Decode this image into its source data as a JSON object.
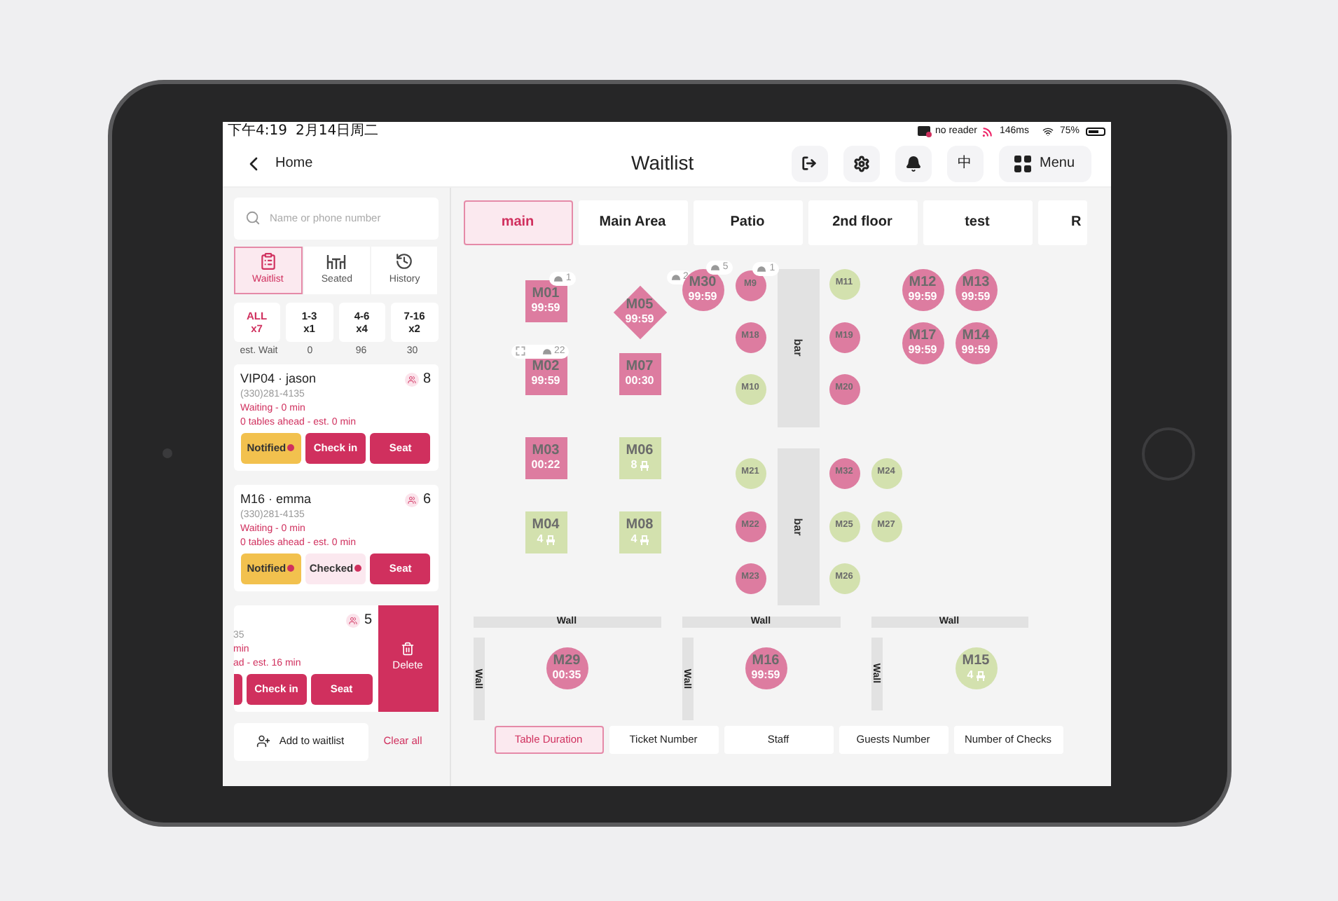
{
  "status_bar": {
    "time": "下午4:19",
    "date": "2月14日周二",
    "reader": "no reader",
    "latency": "146ms",
    "battery": "75%"
  },
  "header": {
    "back": "Home",
    "title": "Waitlist",
    "language": "中",
    "menu": "Menu"
  },
  "search": {
    "placeholder": "Name or phone number"
  },
  "views": [
    {
      "label": "Waitlist",
      "selected": true
    },
    {
      "label": "Seated",
      "selected": false
    },
    {
      "label": "History",
      "selected": false
    }
  ],
  "filters": [
    {
      "label": "ALL",
      "count": "x7",
      "selected": true
    },
    {
      "label": "1-3",
      "count": "x1",
      "selected": false
    },
    {
      "label": "4-6",
      "count": "x4",
      "selected": false
    },
    {
      "label": "7-16",
      "count": "x2",
      "selected": false
    }
  ],
  "wait_row": [
    "est. Wait",
    "0",
    "96",
    "30"
  ],
  "entries": [
    {
      "title": "VIP04 · jason",
      "party": "8",
      "phone": "(330)281-4135",
      "status": "Waiting - 0 min",
      "ahead": "0 tables ahead - est. 0 min",
      "swiped": false,
      "buttons": [
        {
          "label": "Notified",
          "kind": "notified"
        },
        {
          "label": "Check in",
          "kind": "action"
        },
        {
          "label": "Seat",
          "kind": "action"
        }
      ]
    },
    {
      "title": "M16 · emma",
      "party": "6",
      "phone": "(330)281-4135",
      "status": "Waiting - 0 min",
      "ahead": "0 tables ahead - est. 0 min",
      "swiped": false,
      "buttons": [
        {
          "label": "Notified",
          "kind": "notified"
        },
        {
          "label": "Checked",
          "kind": "checked"
        },
        {
          "label": "Seat",
          "kind": "action"
        }
      ]
    },
    {
      "party": "5",
      "phone": "35",
      "status": "min",
      "ahead": "ad - est. 16 min",
      "swiped": true,
      "delete": "Delete",
      "buttons": [
        {
          "label": "Check in",
          "kind": "action"
        },
        {
          "label": "Seat",
          "kind": "action"
        }
      ]
    }
  ],
  "add_button": "Add to waitlist",
  "clear_button": "Clear all",
  "areas": [
    {
      "label": "main",
      "selected": true
    },
    {
      "label": "Main Area",
      "selected": false
    },
    {
      "label": "Patio",
      "selected": false
    },
    {
      "label": "2nd floor",
      "selected": false
    },
    {
      "label": "test",
      "selected": false
    },
    {
      "label": "R",
      "selected": false
    }
  ],
  "tables": [
    {
      "label": "M01",
      "time": "99:59",
      "kind": "square",
      "color": "#dd7ca0",
      "badge": {
        "count": "1",
        "linked": false
      }
    },
    {
      "label": "M05",
      "time": "99:59",
      "kind": "diamond",
      "color": "#dd7ca0",
      "badge": {
        "count": "2",
        "linked": false
      }
    },
    {
      "label": "M30",
      "time": "99:59",
      "kind": "circle",
      "color": "#dd7ca0",
      "badge": {
        "count": "5",
        "linked": false
      }
    },
    {
      "label": "M9",
      "kind": "small",
      "color": "#dd7ca0",
      "badge": {
        "count": "1",
        "linked": false
      }
    },
    {
      "label": "M11",
      "kind": "small",
      "color": "#d3e1ae"
    },
    {
      "label": "M12",
      "time": "99:59",
      "kind": "circle",
      "color": "#dd7ca0"
    },
    {
      "label": "M13",
      "time": "99:59",
      "kind": "circle",
      "color": "#dd7ca0"
    },
    {
      "label": "M02",
      "time": "99:59",
      "kind": "square",
      "color": "#dd7ca0",
      "badge": {
        "count": "22",
        "linked": true
      }
    },
    {
      "label": "M07",
      "time": "00:30",
      "kind": "square",
      "color": "#dd7ca0"
    },
    {
      "label": "M18",
      "kind": "small",
      "color": "#dd7ca0"
    },
    {
      "label": "M19",
      "kind": "small",
      "color": "#dd7ca0"
    },
    {
      "label": "M17",
      "time": "99:59",
      "kind": "circle",
      "color": "#dd7ca0"
    },
    {
      "label": "M14",
      "time": "99:59",
      "kind": "circle",
      "color": "#dd7ca0"
    },
    {
      "label": "M10",
      "kind": "small",
      "color": "#d3e1ae"
    },
    {
      "label": "M20",
      "kind": "small",
      "color": "#dd7ca0"
    },
    {
      "label": "M03",
      "time": "00:22",
      "kind": "square",
      "color": "#dd7ca0"
    },
    {
      "label": "M06",
      "seats": "8",
      "kind": "square",
      "color": "#d3e1ae"
    },
    {
      "label": "M21",
      "kind": "small",
      "color": "#d3e1ae"
    },
    {
      "label": "M32",
      "kind": "small",
      "color": "#dd7ca0"
    },
    {
      "label": "M24",
      "kind": "small",
      "color": "#d3e1ae"
    },
    {
      "label": "M04",
      "seats": "4",
      "kind": "square",
      "color": "#d3e1ae"
    },
    {
      "label": "M08",
      "seats": "4",
      "kind": "square",
      "color": "#d3e1ae"
    },
    {
      "label": "M22",
      "kind": "small",
      "color": "#dd7ca0"
    },
    {
      "label": "M25",
      "kind": "small",
      "color": "#d3e1ae"
    },
    {
      "label": "M27",
      "kind": "small",
      "color": "#d3e1ae"
    },
    {
      "label": "M23",
      "kind": "small",
      "color": "#dd7ca0"
    },
    {
      "label": "M26",
      "kind": "small",
      "color": "#d3e1ae"
    },
    {
      "label": "M29",
      "time": "00:35",
      "kind": "circle",
      "color": "#dd7ca0"
    },
    {
      "label": "M16",
      "time": "99:59",
      "kind": "circle",
      "color": "#dd7ca0"
    },
    {
      "label": "M15",
      "seats": "4",
      "kind": "circle",
      "color": "#d3e1ae"
    }
  ],
  "fixtures": [
    {
      "kind": "bar",
      "label": "bar"
    },
    {
      "kind": "bar",
      "label": "bar"
    },
    {
      "kind": "wall",
      "label": "Wall"
    },
    {
      "kind": "wall",
      "label": "Wall"
    },
    {
      "kind": "wall",
      "label": "Wall"
    },
    {
      "kind": "wall",
      "label": "Wall"
    },
    {
      "kind": "wall",
      "label": "Wall"
    },
    {
      "kind": "wall",
      "label": "Wall"
    }
  ],
  "display_modes": [
    {
      "label": "Table Duration",
      "selected": true
    },
    {
      "label": "Ticket Number",
      "selected": false
    },
    {
      "label": "Staff",
      "selected": false
    },
    {
      "label": "Guests Number",
      "selected": false
    },
    {
      "label": "Number of Checks",
      "selected": false
    }
  ]
}
